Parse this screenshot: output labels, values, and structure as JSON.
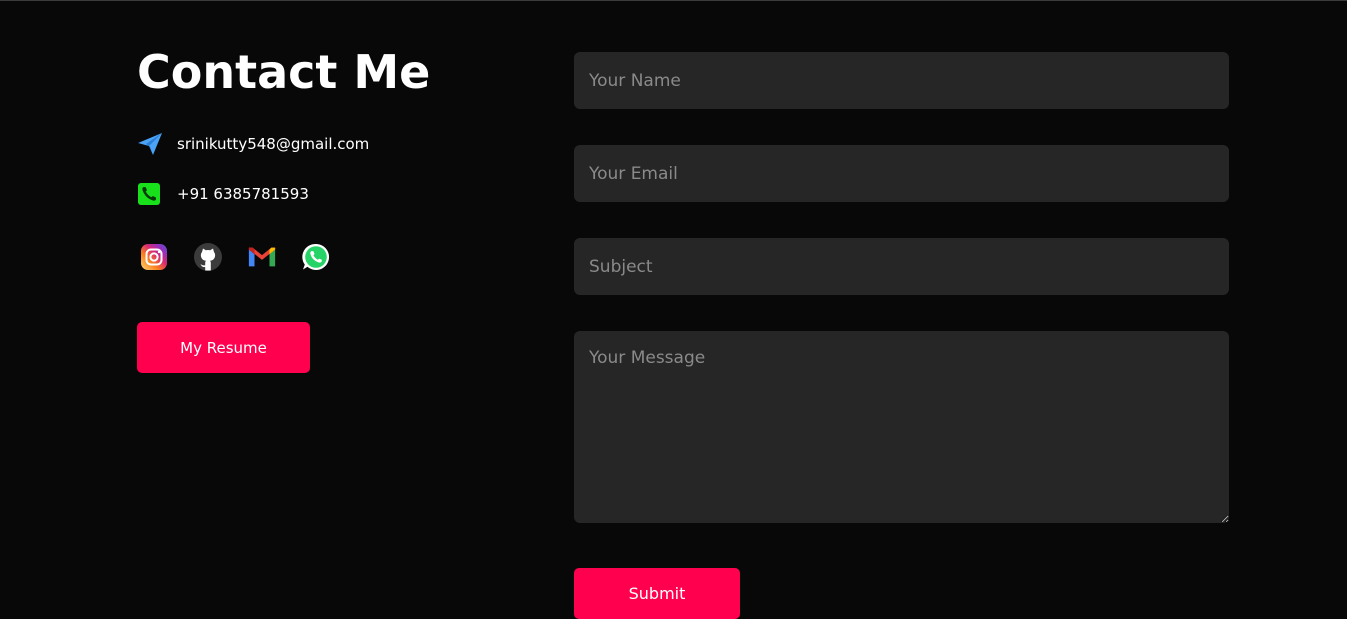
{
  "contact": {
    "title": "Contact Me",
    "email": "srinikutty548@gmail.com",
    "phone": "+91 6385781593",
    "socials": [
      {
        "name": "instagram-icon"
      },
      {
        "name": "github-icon"
      },
      {
        "name": "gmail-icon"
      },
      {
        "name": "whatsapp-icon"
      }
    ],
    "resume_label": "My Resume"
  },
  "form": {
    "name_placeholder": "Your Name",
    "email_placeholder": "Your Email",
    "subject_placeholder": "Subject",
    "message_placeholder": "Your Message",
    "submit_label": "Submit"
  },
  "colors": {
    "background": "#080808",
    "accent": "#ff004f",
    "field": "#262626"
  }
}
